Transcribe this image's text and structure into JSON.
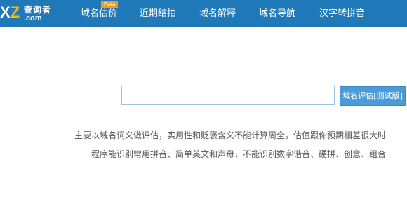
{
  "header": {
    "logo": {
      "mark_x": "X",
      "mark_z": "Z",
      "name_cn": "查询者",
      "domain": ".com"
    },
    "nav": [
      {
        "label": "域名估价",
        "badge": "Beta"
      },
      {
        "label": "近期结拍"
      },
      {
        "label": "域名解释"
      },
      {
        "label": "域名导航"
      },
      {
        "label": "汉字转拼音"
      }
    ]
  },
  "search": {
    "value": "",
    "button_label": "域名评估[测试版]"
  },
  "description": {
    "line1": "主要以域名词义做评估，实用性和贬褒含义不能计算周全，估值跟你预期相差很大时",
    "line2": "程序能识别常用拼音、简单英文和声母，不能识别数字谐音、硬拼、创意、组合"
  },
  "colors": {
    "header_bg": "#1f78b8",
    "button_bg": "#4a9bd6",
    "badge_bg": "#f39a1a",
    "input_border": "#9cc3e3"
  }
}
